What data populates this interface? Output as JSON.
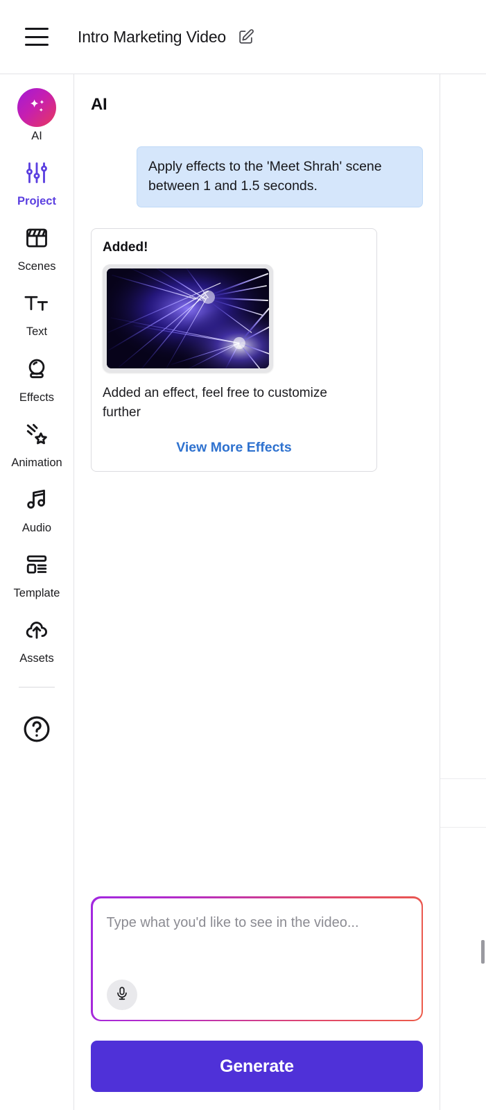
{
  "header": {
    "menu_icon": "hamburger-menu-icon",
    "title": "Intro Marketing Video",
    "edit_icon": "edit-pencil-icon"
  },
  "sidebar": {
    "items": [
      {
        "label": "AI",
        "icon": "ai-sparkle-icon",
        "active": false
      },
      {
        "label": "Project",
        "icon": "sliders-icon",
        "active": true
      },
      {
        "label": "Scenes",
        "icon": "clapperboard-icon",
        "active": false
      },
      {
        "label": "Text",
        "icon": "text-tt-icon",
        "active": false
      },
      {
        "label": "Effects",
        "icon": "crystal-ball-icon",
        "active": false
      },
      {
        "label": "Animation",
        "icon": "shooting-star-icon",
        "active": false
      },
      {
        "label": "Audio",
        "icon": "music-note-icon",
        "active": false
      },
      {
        "label": "Template",
        "icon": "layout-template-icon",
        "active": false
      },
      {
        "label": "Assets",
        "icon": "cloud-upload-icon",
        "active": false
      }
    ],
    "help": {
      "label": "",
      "icon": "help-circle-icon"
    },
    "active_color": "#5b3fe0"
  },
  "panel": {
    "title": "AI"
  },
  "conversation": {
    "user_message": "Apply effects to the 'Meet Shrah' scene between 1 and 1.5 seconds.",
    "result": {
      "heading": "Added!",
      "thumbnail_icon": "laser-beams-effect-thumbnail",
      "description": "Added an effect, feel free to customize further",
      "link_label": "View More Effects",
      "link_color": "#2f72cf"
    }
  },
  "composer": {
    "placeholder": "Type what you'd like to see in the video...",
    "value": "",
    "mic_icon": "microphone-icon",
    "generate_label": "Generate",
    "generate_color": "#4f31d8",
    "border_gradient_from": "#a228e0",
    "border_gradient_to": "#ec5b49"
  }
}
